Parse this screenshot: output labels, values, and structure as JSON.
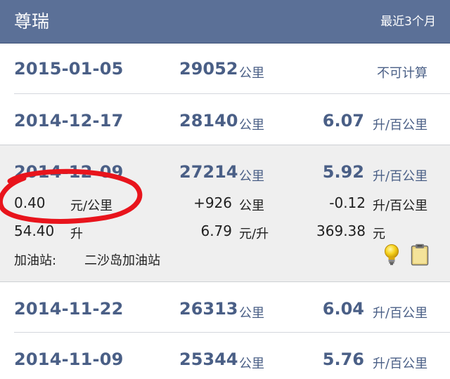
{
  "header": {
    "title": "尊瑞",
    "filter_label": "最近3个月"
  },
  "rows": [
    {
      "date": "2015-01-05",
      "mileage": "29052",
      "mileage_unit": "公里",
      "consumption_text": "不可计算"
    },
    {
      "date": "2014-12-17",
      "mileage": "28140",
      "mileage_unit": "公里",
      "consumption": "6.07",
      "consumption_unit": "升/百公里"
    },
    {
      "date": "2014-12-09",
      "mileage": "27214",
      "mileage_unit": "公里",
      "consumption": "5.92",
      "consumption_unit": "升/百公里",
      "details": {
        "cost_per_km": "0.40",
        "cost_per_km_unit": "元/公里",
        "mileage_delta": "+926",
        "mileage_delta_unit": "公里",
        "consumption_delta": "-0.12",
        "consumption_delta_unit": "升/百公里",
        "fuel_volume": "54.40",
        "fuel_volume_unit": "升",
        "price_per_liter": "6.79",
        "price_per_liter_unit": "元/升",
        "total_cost": "369.38",
        "total_cost_unit": "元",
        "station_label": "加油站:",
        "station_name": "二沙岛加油站"
      }
    },
    {
      "date": "2014-11-22",
      "mileage": "26313",
      "mileage_unit": "公里",
      "consumption": "6.04",
      "consumption_unit": "升/百公里"
    },
    {
      "date": "2014-11-09",
      "mileage": "25344",
      "mileage_unit": "公里",
      "consumption": "5.76",
      "consumption_unit": "升/百公里"
    }
  ],
  "icons": {
    "tip": "lightbulb-icon",
    "note": "clipboard-icon"
  },
  "colors": {
    "header_bg": "#5b7097",
    "primary_text": "#4a5f86",
    "expanded_bg": "#efefef",
    "annotation": "#e8141c"
  }
}
